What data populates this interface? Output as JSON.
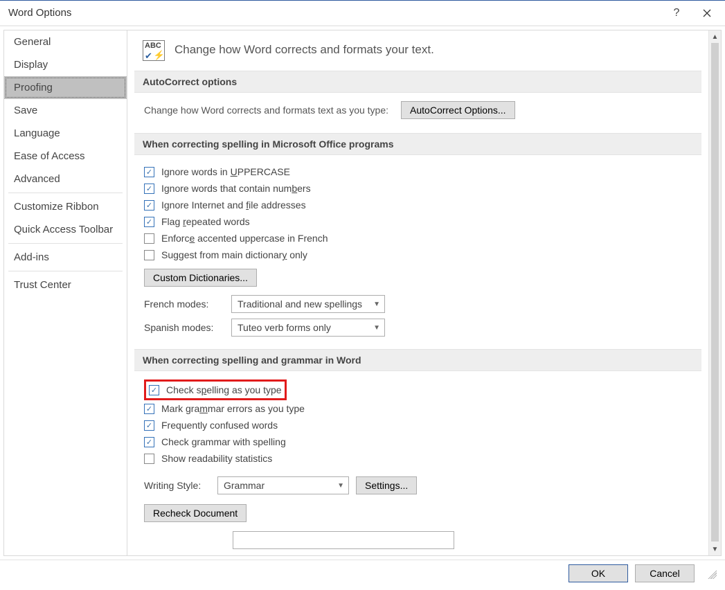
{
  "titlebar": {
    "title": "Word Options"
  },
  "sidebar": {
    "items": [
      {
        "label": "General",
        "active": false
      },
      {
        "label": "Display",
        "active": false
      },
      {
        "label": "Proofing",
        "active": true
      },
      {
        "label": "Save",
        "active": false
      },
      {
        "label": "Language",
        "active": false
      },
      {
        "label": "Ease of Access",
        "active": false
      },
      {
        "label": "Advanced",
        "active": false
      },
      {
        "label": "Customize Ribbon",
        "active": false
      },
      {
        "label": "Quick Access Toolbar",
        "active": false
      },
      {
        "label": "Add-ins",
        "active": false
      },
      {
        "label": "Trust Center",
        "active": false
      }
    ]
  },
  "heading": "Change how Word corrects and formats your text.",
  "section_autocorrect": {
    "header": "AutoCorrect options",
    "desc": "Change how Word corrects and formats text as you type:",
    "button": "AutoCorrect Options..."
  },
  "section_office": {
    "header": "When correcting spelling in Microsoft Office programs",
    "checkboxes": [
      {
        "checked": true,
        "pre": "Ignore words in ",
        "u": "U",
        "post": "PPERCASE"
      },
      {
        "checked": true,
        "pre": "Ignore words that contain num",
        "u": "b",
        "post": "ers"
      },
      {
        "checked": true,
        "pre": "Ignore Internet and ",
        "u": "f",
        "post": "ile addresses"
      },
      {
        "checked": true,
        "pre": "Flag ",
        "u": "r",
        "post": "epeated words"
      },
      {
        "checked": false,
        "pre": "Enforc",
        "u": "e",
        "post": " accented uppercase in French"
      },
      {
        "checked": false,
        "pre": "Suggest from main dictionar",
        "u": "y",
        "post": " only"
      }
    ],
    "custom_dict_btn": "Custom Dictionaries...",
    "french_label_pre": "French ",
    "french_label_u": "m",
    "french_label_post": "odes:",
    "french_value": "Traditional and new spellings",
    "spanish_label_pre": "Spanis",
    "spanish_label_u": "h",
    "spanish_label_post": " modes:",
    "spanish_value": "Tuteo verb forms only"
  },
  "section_word": {
    "header": "When correcting spelling and grammar in Word",
    "checkboxes": [
      {
        "checked": true,
        "pre": "Check s",
        "u": "p",
        "post": "elling as you type",
        "highlight": true
      },
      {
        "checked": true,
        "pre": "Mark gra",
        "u": "m",
        "post": "mar errors as you type"
      },
      {
        "checked": true,
        "pre": "Frequently confused words",
        "u": "",
        "post": ""
      },
      {
        "checked": true,
        "pre": "Check grammar with spelling",
        "u": "",
        "post": ""
      },
      {
        "checked": false,
        "pre": "Show readability statistics",
        "u": "",
        "post": ""
      }
    ],
    "writing_style_label_pre": "",
    "writing_style_label_u": "W",
    "writing_style_label_post": "riting Style:",
    "writing_style_value": "Grammar",
    "settings_btn": "Settings...",
    "recheck_btn": "Recheck Document"
  },
  "footer": {
    "ok": "OK",
    "cancel": "Cancel"
  }
}
